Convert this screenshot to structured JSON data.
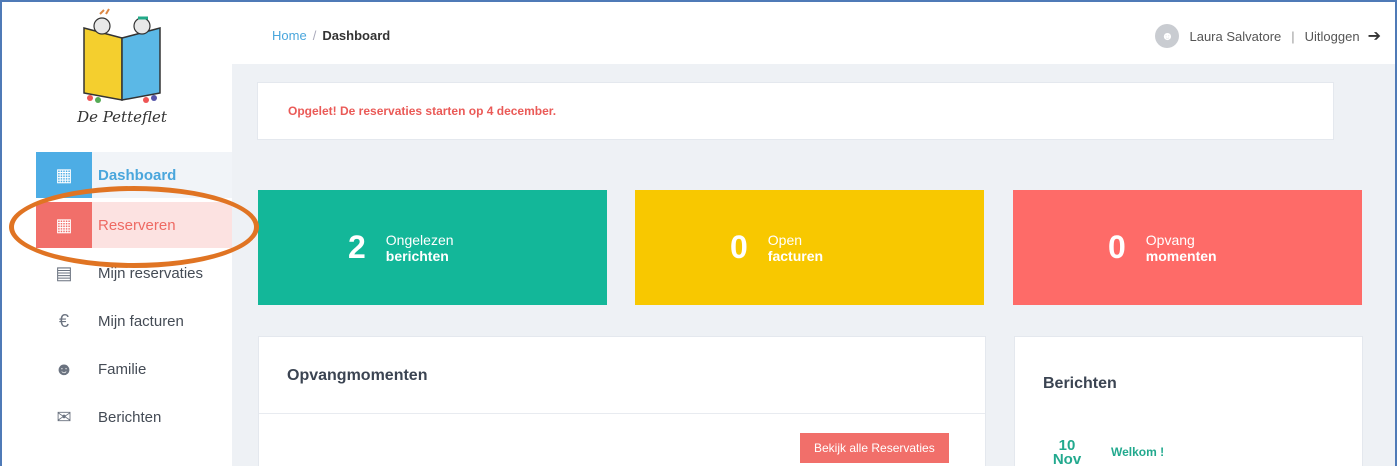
{
  "brand": {
    "name": "De Petteflet"
  },
  "sidebar": {
    "items": [
      {
        "label": "Dashboard",
        "icon": "dashboard-grid-icon"
      },
      {
        "label": "Reserveren",
        "icon": "calendar-icon"
      },
      {
        "label": "Mijn reservaties",
        "icon": "document-icon"
      },
      {
        "label": "Mijn facturen",
        "icon": "euro-icon"
      },
      {
        "label": "Familie",
        "icon": "family-icon"
      },
      {
        "label": "Berichten",
        "icon": "mail-icon"
      }
    ]
  },
  "header": {
    "breadcrumb": {
      "home": "Home",
      "separator": "/",
      "current": "Dashboard"
    },
    "user": {
      "name": "Laura Salvatore",
      "divider": "|",
      "logout": "Uitloggen"
    }
  },
  "alert": {
    "text": "Opgelet! De reservaties starten op 4 december."
  },
  "stats": [
    {
      "value": "2",
      "line1": "Ongelezen",
      "line2": "berichten",
      "color": "#13b799"
    },
    {
      "value": "0",
      "line1": "Open",
      "line2": "facturen",
      "color": "#f8c800"
    },
    {
      "value": "0",
      "line1": "Opvang",
      "line2": "momenten",
      "color": "#fe6b68"
    }
  ],
  "opvang_card": {
    "title": "Opvangmomenten",
    "button": "Bekijk alle Reservaties"
  },
  "berichten_card": {
    "title": "Berichten",
    "message": {
      "day": "10",
      "month": "Nov",
      "title": "Welkom !"
    }
  },
  "colors": {
    "accent_blue": "#4dade5",
    "accent_red": "#f16f6a",
    "annotation": "#e07423"
  }
}
